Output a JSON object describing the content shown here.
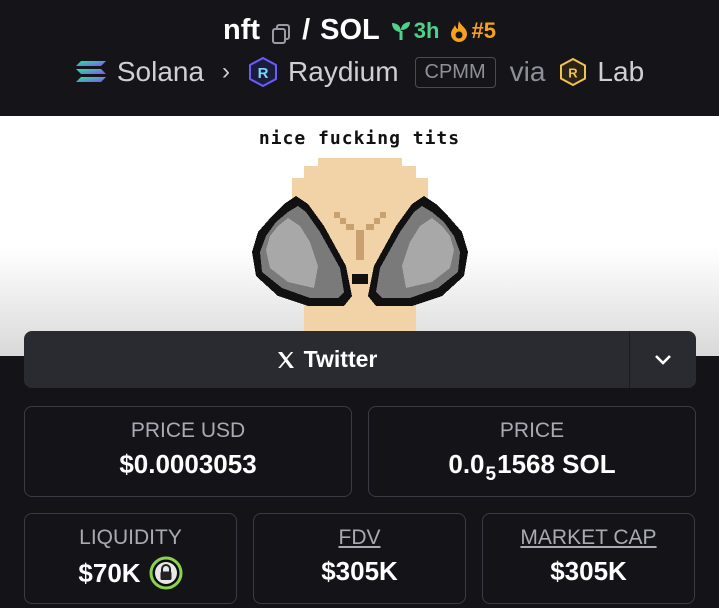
{
  "header": {
    "token_symbol": "nft",
    "slash": "/",
    "quote_symbol": "SOL",
    "age": "3h",
    "rank": "#5",
    "chain": "Solana",
    "dex": "Raydium",
    "pool_type": "CPMM",
    "via": "via",
    "launchpad": "Lab"
  },
  "banner": {
    "caption": "nice fucking tits"
  },
  "social": {
    "twitter_label": "Twitter"
  },
  "stats": {
    "price_usd_label": "PRICE USD",
    "price_usd_value": "$0.0003053",
    "price_label": "PRICE",
    "price_prefix": "0.0",
    "price_zero_count": "5",
    "price_suffix": "1568 SOL",
    "liquidity_label": "LIQUIDITY",
    "liquidity_value": "$70K",
    "fdv_label": "FDV",
    "fdv_value": "$305K",
    "market_cap_label": "MARKET CAP",
    "market_cap_value": "$305K"
  },
  "colors": {
    "background": "#141418",
    "age_green": "#4fd18b",
    "rank_orange": "#f6a21b",
    "lock_green": "#8bd24e"
  }
}
